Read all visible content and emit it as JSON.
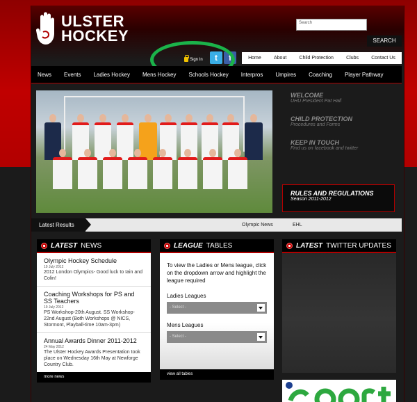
{
  "brand": {
    "logo_line1": "ULSTER",
    "logo_line2": "HOCKEY"
  },
  "search": {
    "placeholder": "Search",
    "button_label": "SEARCH"
  },
  "account": {
    "signin_label": "Sign In"
  },
  "social": {
    "twitter_glyph": "t",
    "facebook_glyph": "f"
  },
  "top_nav": {
    "items": [
      "Home",
      "About",
      "Child Protection",
      "Clubs",
      "Contact Us"
    ]
  },
  "main_nav": {
    "items": [
      "News",
      "Events",
      "Ladies Hockey",
      "Mens Hockey",
      "Schools Hockey",
      "Interpros",
      "Umpires",
      "Coaching",
      "Player Pathway"
    ]
  },
  "side_panel": {
    "items": [
      {
        "title": "WELCOME",
        "subtitle": "UHU President Pat Hall"
      },
      {
        "title": "CHILD PROTECTION",
        "subtitle": "Procedures and Forms"
      },
      {
        "title": "KEEP IN TOUCH",
        "subtitle": "Find us on facebook and twitter"
      }
    ],
    "active": {
      "title": "RULES AND REGULATIONS",
      "subtitle": "Season 2011-2012"
    }
  },
  "results_bar": {
    "tab_label": "Latest Results",
    "links": [
      "Olympic News",
      "EHL"
    ]
  },
  "news": {
    "heading_bold": "LATEST",
    "heading_thin": "NEWS",
    "items": [
      {
        "title": "Olympic Hockey Schedule",
        "date": "19 July 2012",
        "body": "2012 London Olympics- Good luck to Iain and Colin!"
      },
      {
        "title": "Coaching Workshops for PS and SS Teachers",
        "date": "19 July 2012",
        "body": "PS Workshop-20th August. SS Workshop-22nd August (Both Workshops @ NICS, Stormont, Playball-time 10am-3pm)"
      },
      {
        "title": "Annual Awards Dinner 2011-2012",
        "date": "24 May 2012",
        "body": "The Ulster Hockey Awards Presentation took place on Wednesday 16th May at Newforge Country Club."
      }
    ],
    "footer_label": "more news"
  },
  "league": {
    "heading_bold": "LEAGUE",
    "heading_thin": "TABLES",
    "intro": "To view the Ladies or Mens league, click on the dropdown arrow and highlight the league required",
    "ladies_label": "Ladies Leagues",
    "ladies_select": "- Select -",
    "mens_label": "Mens Leagues",
    "mens_select": "- Select -",
    "footer_label": "view all tables"
  },
  "twitter_box": {
    "heading_bold": "LATEST",
    "heading_thin": "TWITTER UPDATES"
  },
  "colors": {
    "brand_red": "#c00000",
    "nav_black": "#000000",
    "annotation_green": "#1bb34a"
  }
}
